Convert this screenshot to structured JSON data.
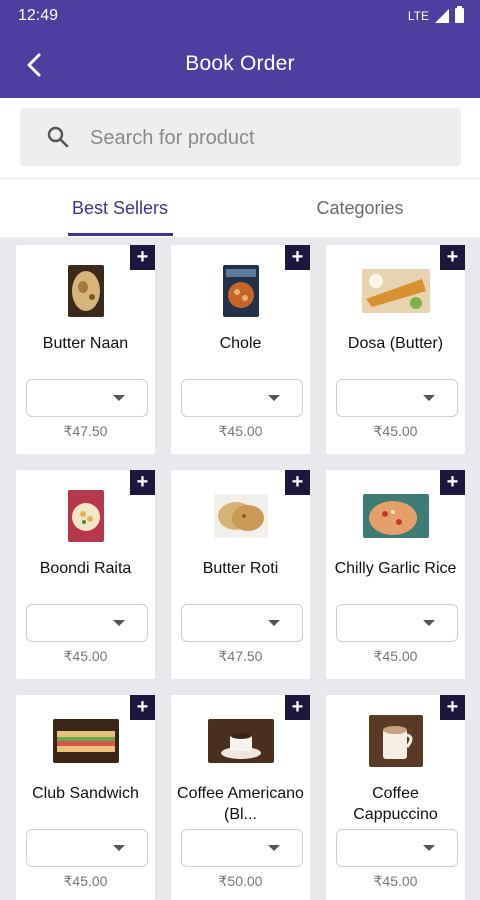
{
  "status": {
    "time": "12:49",
    "network": "LTE"
  },
  "appbar": {
    "title": "Book Order"
  },
  "search": {
    "placeholder": "Search for product",
    "value": ""
  },
  "tabs": [
    {
      "label": "Best Sellers",
      "active": true
    },
    {
      "label": "Categories",
      "active": false
    }
  ],
  "colors": {
    "primary": "#4d3fa0",
    "accent": "#3d3493",
    "plus_button": "#1d1740",
    "background": "#e9e9ed"
  },
  "products": [
    {
      "name": "Butter Naan",
      "price": "₹47.50",
      "image": "butter-naan-image"
    },
    {
      "name": "Chole",
      "price": "₹45.00",
      "image": "chole-image"
    },
    {
      "name": "Dosa (Butter)",
      "price": "₹45.00",
      "image": "dosa-image"
    },
    {
      "name": "Boondi Raita",
      "price": "₹45.00",
      "image": "boondi-raita-image"
    },
    {
      "name": "Butter Roti",
      "price": "₹47.50",
      "image": "butter-roti-image"
    },
    {
      "name": "Chilly Garlic Rice",
      "price": "₹45.00",
      "image": "chilly-garlic-rice-image"
    },
    {
      "name": "Club Sandwich",
      "price": "₹45.00",
      "image": "club-sandwich-image"
    },
    {
      "name": "Coffee Americano (Bl...",
      "price": "₹50.00",
      "image": "coffee-americano-image"
    },
    {
      "name": "Coffee Cappuccino",
      "price": "₹45.00",
      "image": "coffee-cappuccino-image"
    }
  ]
}
